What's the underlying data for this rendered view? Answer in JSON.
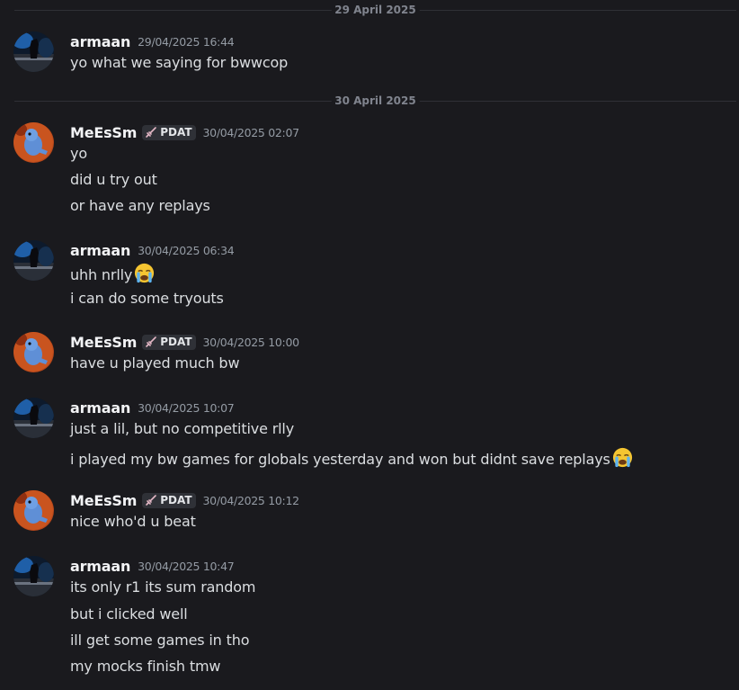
{
  "dividers": [
    "29 April 2025",
    "30 April 2025"
  ],
  "messages": [
    {
      "author": "armaan",
      "time": "29/04/2025 16:44",
      "lines": [
        "yo what we saying for bwwcop"
      ]
    },
    {
      "author": "MeEsSm",
      "tag": "PDAT",
      "time": "30/04/2025 02:07",
      "lines": [
        "yo",
        "did u try out",
        "or have any replays"
      ]
    },
    {
      "author": "armaan",
      "time": "30/04/2025 06:34",
      "lines": [
        "uhh nrlly",
        "i can do some tryouts"
      ]
    },
    {
      "author": "MeEsSm",
      "tag": "PDAT",
      "time": "30/04/2025 10:00",
      "lines": [
        "have u played much bw"
      ]
    },
    {
      "author": "armaan",
      "time": "30/04/2025 10:07",
      "lines": [
        "just a lil, but no competitive rlly",
        "i played my bw games for globals yesterday and won but didnt save replays"
      ]
    },
    {
      "author": "MeEsSm",
      "tag": "PDAT",
      "time": "30/04/2025 10:12",
      "lines": [
        "nice who'd u beat"
      ]
    },
    {
      "author": "armaan",
      "time": "30/04/2025 10:47",
      "lines": [
        "its only r1 its sum random",
        "but i clicked well",
        "ill get some games in tho",
        "my mocks finish tmw"
      ]
    }
  ],
  "emojis": {
    "crying": "sob-emoji"
  },
  "colors": {
    "background": "#1a1a1e",
    "username": "#f2f3f5",
    "text": "#dbdee1",
    "timestamp": "#949ba4"
  }
}
